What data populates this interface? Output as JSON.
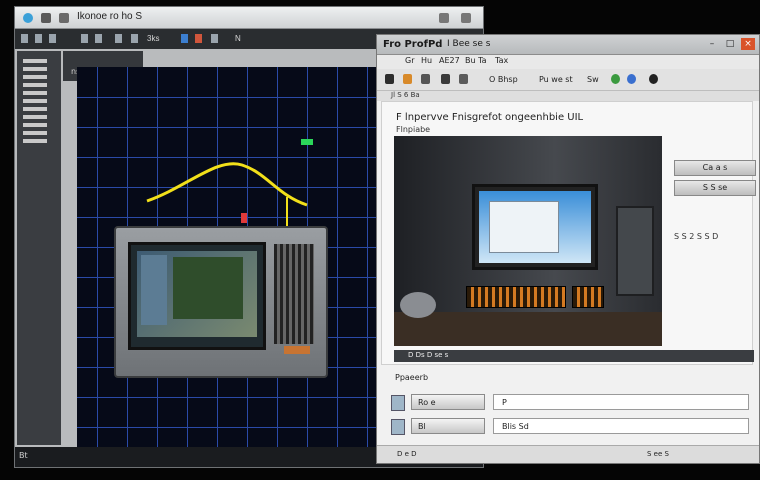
{
  "left_window": {
    "title": "Ikonoe ro ho S",
    "toolbar_labels": [
      "3ks",
      "N"
    ],
    "panel_label": "ns w s",
    "status": "Bt"
  },
  "right_window": {
    "title": "Fro ProfPd",
    "title_suffix": "I Bee se s",
    "menu": [
      "Gr",
      "Hu",
      "AE27",
      "Bu Ta",
      "Tax"
    ],
    "toolbar": [
      "O Bhsp",
      "Pu we st",
      "Sw"
    ],
    "subbar": "Jl S 6 Ba",
    "doc_heading": "F lnpervve Fnisgrefot ongeenhbie UIL",
    "doc_subheading": "Flnpiabe",
    "side_buttons": [
      "Ca a s",
      "S S se"
    ],
    "side_note": "S S 2 S S D",
    "caption": "D Ds D se s",
    "section_label": "Ppaeerb",
    "rows": [
      {
        "button": "Ro e",
        "field": "P"
      },
      {
        "button": "Bl",
        "field": "Blis Sd"
      }
    ],
    "status_left": "D e D",
    "status_right": "S ee S"
  },
  "colors": {
    "canvas_bg": "#060a18",
    "grid": "#2a4aa8",
    "accent_yellow": "#f2e01a",
    "keyboard_orange": "#d47a22"
  }
}
